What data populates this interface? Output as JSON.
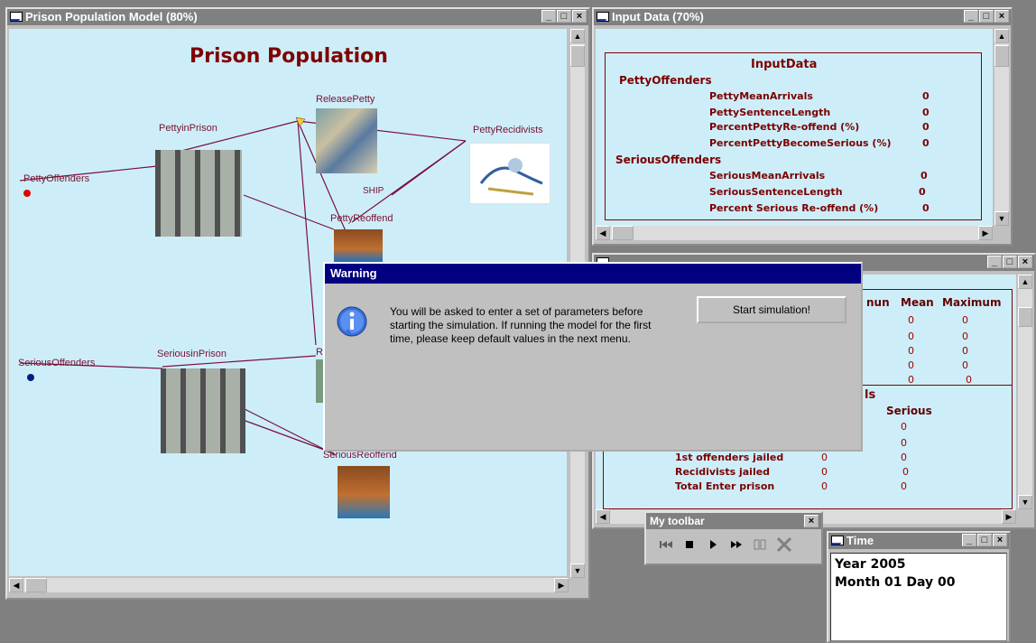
{
  "windows": {
    "model": {
      "title": "Prison Population Model (80%)",
      "heading": "Prison Population"
    },
    "input": {
      "title": "Input Data (70%)"
    },
    "output": {
      "title": ""
    },
    "time": {
      "title": "Time",
      "year": "Year 2005",
      "monthday": "Month 01 Day 00"
    }
  },
  "title_buttons": {
    "min": "_",
    "max": "□",
    "close": "×"
  },
  "diagram": {
    "labels": {
      "release_petty": "ReleasePetty",
      "petty_in_prison": "PettyinPrison",
      "petty_recidivists": "PettyRecidivists",
      "petty_offenders": "PettyOffenders",
      "ship": "SHIP",
      "petty_reoffend": "PettyReoffend",
      "serious_in_prison": "SeriousinPrison",
      "serious_offenders": "SeriousOffenders",
      "serious_reoffend": "SeriousReoffend",
      "release_serious_partial": "R"
    }
  },
  "input_data": {
    "title": "InputData",
    "petty_header": "PettyOffenders",
    "petty_rows": [
      {
        "label": "PettyMeanArrivals",
        "value": "0"
      },
      {
        "label": "PettySentenceLength",
        "value": "0"
      },
      {
        "label": "PercentPettyRe-offend (%)",
        "value": "0"
      },
      {
        "label": "PercentPettyBecomeSerious (%)",
        "value": "0"
      }
    ],
    "serious_header": "SeriousOffenders",
    "serious_rows": [
      {
        "label": "SeriousMeanArrivals",
        "value": "0"
      },
      {
        "label": "SeriousSentenceLength",
        "value": "0"
      },
      {
        "label": "Percent Serious Re-offend (%)",
        "value": "0"
      }
    ]
  },
  "output_data": {
    "col_min": "nun",
    "col_mean": "Mean",
    "col_max": "Maximum",
    "stats_rows": [
      {
        "min": "0",
        "max": "0"
      },
      {
        "min": "0",
        "max": "0"
      },
      {
        "min": "0",
        "max": "0"
      },
      {
        "min": "0",
        "max": "0"
      },
      {
        "min": "0",
        "max": "0"
      }
    ],
    "section2_partial": "ls",
    "col_serious": "Serious",
    "rows2": [
      {
        "label": "",
        "a": "",
        "b": "0"
      },
      {
        "label": "",
        "a": "",
        "b": "0"
      },
      {
        "label": "1st offenders jailed",
        "a": "0",
        "b": "0"
      },
      {
        "label": "Recidivists jailed",
        "a": "0",
        "b": "0"
      },
      {
        "label": "Total Enter prison",
        "a": "0",
        "b": "0"
      }
    ]
  },
  "toolbar": {
    "title": "My toolbar",
    "close": "×"
  },
  "dialog": {
    "title": "Warning",
    "message": "You will be asked to enter a set of parameters before starting the simulation. If running the model for the first time, please keep default values in the next menu.",
    "button": "Start simulation!"
  },
  "colors": {
    "canvas": "#cdeef9",
    "dialog_title": "#000080",
    "label": "#7a1030",
    "heading": "#800000"
  }
}
